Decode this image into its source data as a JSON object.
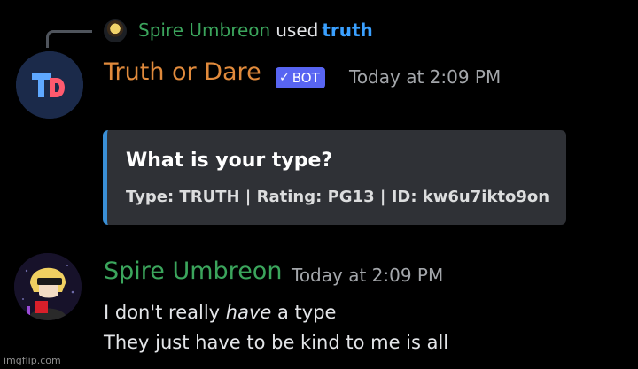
{
  "reply": {
    "username": "Spire Umbreon",
    "used_text": "used",
    "command": "truth"
  },
  "bot_message": {
    "author": "Truth or Dare",
    "badge_label": "BOT",
    "timestamp": "Today at 2:09 PM",
    "avatar_initials": "TD",
    "embed": {
      "title": "What is your type?",
      "footer": "Type: TRUTH | Rating: PG13 | ID: kw6u7ikto9on",
      "accent_color": "#3a8fd6"
    }
  },
  "user_message": {
    "author": "Spire Umbreon",
    "timestamp": "Today at 2:09 PM",
    "line1_prefix": "I don't really",
    "line1_emphasis": "have",
    "line1_suffix": "a type",
    "line2": "They just have to be kind to me is all"
  },
  "watermark": "imgflip.com",
  "colors": {
    "background": "#000000",
    "username_green": "#3ba55c",
    "bot_name_orange": "#e08a3c",
    "command_blue": "#3aa0ff",
    "bot_badge": "#5865f2",
    "embed_bg": "#2f3136"
  }
}
